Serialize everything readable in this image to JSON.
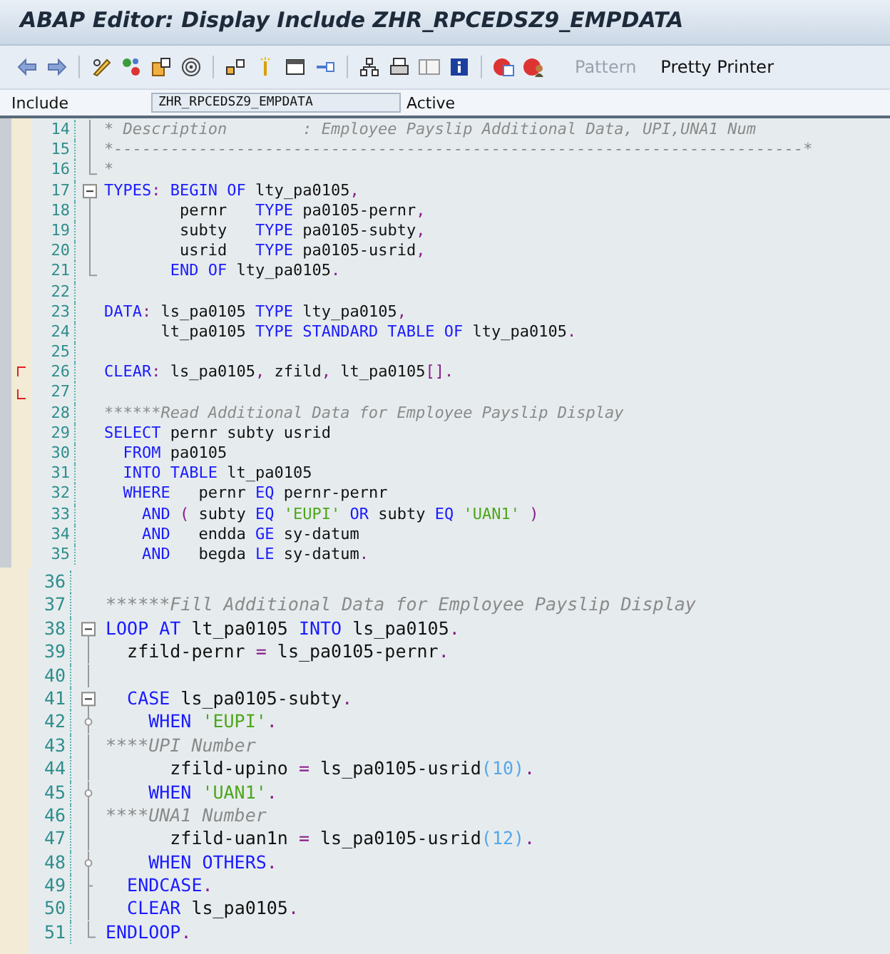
{
  "window": {
    "title": "ABAP Editor: Display Include ZHR_RPCEDSZ9_EMPDATA"
  },
  "toolbar": {
    "buttons": [
      {
        "label": "Pattern",
        "disabled": true
      },
      {
        "label": "Pretty Printer",
        "disabled": false
      }
    ]
  },
  "object_row": {
    "label": "Include",
    "value": "ZHR_RPCEDSZ9_EMPDATA",
    "status": "Active"
  },
  "editors": [
    {
      "lines": [
        {
          "number": "14",
          "kind": "guide",
          "tokens": [
            {
              "kind": "comment",
              "text": "* Description        : Employee Payslip Additional Data, UPI,UNA1 Num"
            }
          ]
        },
        {
          "number": "15",
          "kind": "guide",
          "tokens": [
            {
              "kind": "comment",
              "text": "*-------------------------------------------------------------------------*"
            }
          ]
        },
        {
          "number": "16",
          "kind": "end",
          "tokens": [
            {
              "kind": "comment",
              "text": "*"
            }
          ]
        },
        {
          "number": "17",
          "kind": "start",
          "tokens": [
            {
              "kind": "keyword",
              "text": "TYPES"
            },
            {
              "kind": "punct",
              "text": ":"
            },
            {
              "kind": "keyword",
              "text": " BEGIN OF"
            },
            {
              "kind": "text",
              "text": " lty_pa0105"
            },
            {
              "kind": "punct",
              "text": ","
            }
          ]
        },
        {
          "number": "18",
          "kind": "guide",
          "tokens": [
            {
              "kind": "text",
              "text": "        pernr   "
            },
            {
              "kind": "keyword",
              "text": "TYPE"
            },
            {
              "kind": "text",
              "text": " pa0105-pernr"
            },
            {
              "kind": "punct",
              "text": ","
            }
          ]
        },
        {
          "number": "19",
          "kind": "guide",
          "tokens": [
            {
              "kind": "text",
              "text": "        subty   "
            },
            {
              "kind": "keyword",
              "text": "TYPE"
            },
            {
              "kind": "text",
              "text": " pa0105-subty"
            },
            {
              "kind": "punct",
              "text": ","
            }
          ]
        },
        {
          "number": "20",
          "kind": "guide",
          "tokens": [
            {
              "kind": "text",
              "text": "        usrid   "
            },
            {
              "kind": "keyword",
              "text": "TYPE"
            },
            {
              "kind": "text",
              "text": " pa0105-usrid"
            },
            {
              "kind": "punct",
              "text": ","
            }
          ]
        },
        {
          "number": "21",
          "kind": "end",
          "tokens": [
            {
              "kind": "keyword",
              "text": "       END OF"
            },
            {
              "kind": "text",
              "text": " lty_pa0105"
            },
            {
              "kind": "punct",
              "text": "."
            }
          ]
        },
        {
          "number": "22",
          "kind": "plain"
        },
        {
          "number": "23",
          "kind": "plain",
          "tokens": [
            {
              "kind": "keyword",
              "text": "DATA"
            },
            {
              "kind": "punct",
              "text": ":"
            },
            {
              "kind": "text",
              "text": " ls_pa0105 "
            },
            {
              "kind": "keyword",
              "text": "TYPE"
            },
            {
              "kind": "text",
              "text": " lty_pa0105"
            },
            {
              "kind": "punct",
              "text": ","
            }
          ]
        },
        {
          "number": "24",
          "kind": "plain",
          "tokens": [
            {
              "kind": "text",
              "text": "      lt_pa0105 "
            },
            {
              "kind": "keyword",
              "text": "TYPE STANDARD TABLE OF"
            },
            {
              "kind": "text",
              "text": " lty_pa0105"
            },
            {
              "kind": "punct",
              "text": "."
            }
          ]
        },
        {
          "number": "25",
          "kind": "plain"
        },
        {
          "number": "26",
          "kind": "plain",
          "marked": true,
          "tokens": [
            {
              "kind": "keyword",
              "text": "CLEAR"
            },
            {
              "kind": "punct",
              "text": ":"
            },
            {
              "kind": "text",
              "text": " ls_pa0105"
            },
            {
              "kind": "punct",
              "text": ","
            },
            {
              "kind": "text",
              "text": " zfild"
            },
            {
              "kind": "punct",
              "text": ","
            },
            {
              "kind": "text",
              "text": " lt_pa0105"
            },
            {
              "kind": "punct",
              "text": "[]."
            }
          ]
        },
        {
          "number": "27",
          "kind": "plain",
          "marked": true
        },
        {
          "number": "28",
          "kind": "plain",
          "tokens": [
            {
              "kind": "comment",
              "text": "******Read Additional Data for Employee Payslip Display"
            }
          ]
        },
        {
          "number": "29",
          "kind": "plain",
          "tokens": [
            {
              "kind": "keyword",
              "text": "SELECT"
            },
            {
              "kind": "text",
              "text": " pernr subty usrid"
            }
          ]
        },
        {
          "number": "30",
          "kind": "plain",
          "tokens": [
            {
              "kind": "keyword",
              "text": "  FROM"
            },
            {
              "kind": "text",
              "text": " pa0105"
            }
          ]
        },
        {
          "number": "31",
          "kind": "plain",
          "tokens": [
            {
              "kind": "keyword",
              "text": "  INTO TABLE"
            },
            {
              "kind": "text",
              "text": " lt_pa0105"
            }
          ]
        },
        {
          "number": "32",
          "kind": "plain",
          "tokens": [
            {
              "kind": "keyword",
              "text": "  WHERE"
            },
            {
              "kind": "text",
              "text": "   pernr "
            },
            {
              "kind": "keyword",
              "text": "EQ"
            },
            {
              "kind": "text",
              "text": " pernr-pernr"
            }
          ]
        },
        {
          "number": "33",
          "kind": "plain",
          "tokens": [
            {
              "kind": "keyword",
              "text": "    AND"
            },
            {
              "kind": "punct",
              "text": " ( "
            },
            {
              "kind": "text",
              "text": "subty "
            },
            {
              "kind": "keyword",
              "text": "EQ "
            },
            {
              "kind": "string",
              "text": "'EUPI'"
            },
            {
              "kind": "keyword",
              "text": " OR"
            },
            {
              "kind": "text",
              "text": " subty "
            },
            {
              "kind": "keyword",
              "text": "EQ "
            },
            {
              "kind": "string",
              "text": "'UAN1'"
            },
            {
              "kind": "punct",
              "text": " )"
            }
          ]
        },
        {
          "number": "34",
          "kind": "plain",
          "tokens": [
            {
              "kind": "keyword",
              "text": "    AND"
            },
            {
              "kind": "text",
              "text": "   endda "
            },
            {
              "kind": "keyword",
              "text": "GE"
            },
            {
              "kind": "text",
              "text": " sy-datum"
            }
          ]
        },
        {
          "number": "35",
          "kind": "plain",
          "tokens": [
            {
              "kind": "keyword",
              "text": "    AND"
            },
            {
              "kind": "text",
              "text": "   begda "
            },
            {
              "kind": "keyword",
              "text": "LE"
            },
            {
              "kind": "text",
              "text": " sy-datum"
            },
            {
              "kind": "punct",
              "text": "."
            }
          ]
        }
      ]
    },
    {
      "lines": [
        {
          "number": "36",
          "kind": "plain"
        },
        {
          "number": "37",
          "kind": "plain",
          "tokens": [
            {
              "kind": "comment",
              "text": "******Fill Additional Data for Employee Payslip Display"
            }
          ]
        },
        {
          "number": "38",
          "kind": "start",
          "tokens": [
            {
              "kind": "keyword",
              "text": "LOOP AT"
            },
            {
              "kind": "text",
              "text": " lt_pa0105 "
            },
            {
              "kind": "keyword",
              "text": "INTO"
            },
            {
              "kind": "text",
              "text": " ls_pa0105"
            },
            {
              "kind": "punct",
              "text": "."
            }
          ]
        },
        {
          "number": "39",
          "kind": "guide",
          "tokens": [
            {
              "kind": "text",
              "text": "  zfild-pernr "
            },
            {
              "kind": "punct",
              "text": "="
            },
            {
              "kind": "text",
              "text": " ls_pa0105-pernr"
            },
            {
              "kind": "punct",
              "text": "."
            }
          ]
        },
        {
          "number": "40",
          "kind": "guide"
        },
        {
          "number": "41",
          "kind": "start",
          "tokens": [
            {
              "kind": "keyword",
              "text": "  CASE"
            },
            {
              "kind": "text",
              "text": " ls_pa0105-subty"
            },
            {
              "kind": "punct",
              "text": "."
            }
          ]
        },
        {
          "number": "42",
          "kind": "branch",
          "tokens": [
            {
              "kind": "keyword",
              "text": "    WHEN "
            },
            {
              "kind": "string",
              "text": "'EUPI'"
            },
            {
              "kind": "punct",
              "text": "."
            }
          ]
        },
        {
          "number": "43",
          "kind": "guide",
          "tokens": [
            {
              "kind": "comment",
              "text": "****UPI Number"
            }
          ]
        },
        {
          "number": "44",
          "kind": "guide",
          "tokens": [
            {
              "kind": "text",
              "text": "      zfild-upino "
            },
            {
              "kind": "punct",
              "text": "="
            },
            {
              "kind": "text",
              "text": " ls_pa0105-usrid"
            },
            {
              "kind": "number",
              "text": "(10)"
            },
            {
              "kind": "punct",
              "text": "."
            }
          ]
        },
        {
          "number": "45",
          "kind": "branch",
          "tokens": [
            {
              "kind": "keyword",
              "text": "    WHEN "
            },
            {
              "kind": "string",
              "text": "'UAN1'"
            },
            {
              "kind": "punct",
              "text": "."
            }
          ]
        },
        {
          "number": "46",
          "kind": "guide",
          "tokens": [
            {
              "kind": "comment",
              "text": "****UNA1 Number"
            }
          ]
        },
        {
          "number": "47",
          "kind": "guide",
          "tokens": [
            {
              "kind": "text",
              "text": "      zfild-uan1n "
            },
            {
              "kind": "punct",
              "text": "="
            },
            {
              "kind": "text",
              "text": " ls_pa0105-usrid"
            },
            {
              "kind": "number",
              "text": "(12)"
            },
            {
              "kind": "punct",
              "text": "."
            }
          ]
        },
        {
          "number": "48",
          "kind": "branch",
          "tokens": [
            {
              "kind": "keyword",
              "text": "    WHEN OTHERS"
            },
            {
              "kind": "punct",
              "text": "."
            }
          ]
        },
        {
          "number": "49",
          "kind": "tick",
          "tokens": [
            {
              "kind": "keyword",
              "text": "  ENDCASE"
            },
            {
              "kind": "punct",
              "text": "."
            }
          ]
        },
        {
          "number": "50",
          "kind": "guide",
          "tokens": [
            {
              "kind": "keyword",
              "text": "  CLEAR"
            },
            {
              "kind": "text",
              "text": " ls_pa0105"
            },
            {
              "kind": "punct",
              "text": "."
            }
          ]
        },
        {
          "number": "51",
          "kind": "end",
          "tokens": [
            {
              "kind": "keyword",
              "text": "ENDLOOP"
            },
            {
              "kind": "punct",
              "text": "."
            }
          ]
        }
      ]
    }
  ]
}
